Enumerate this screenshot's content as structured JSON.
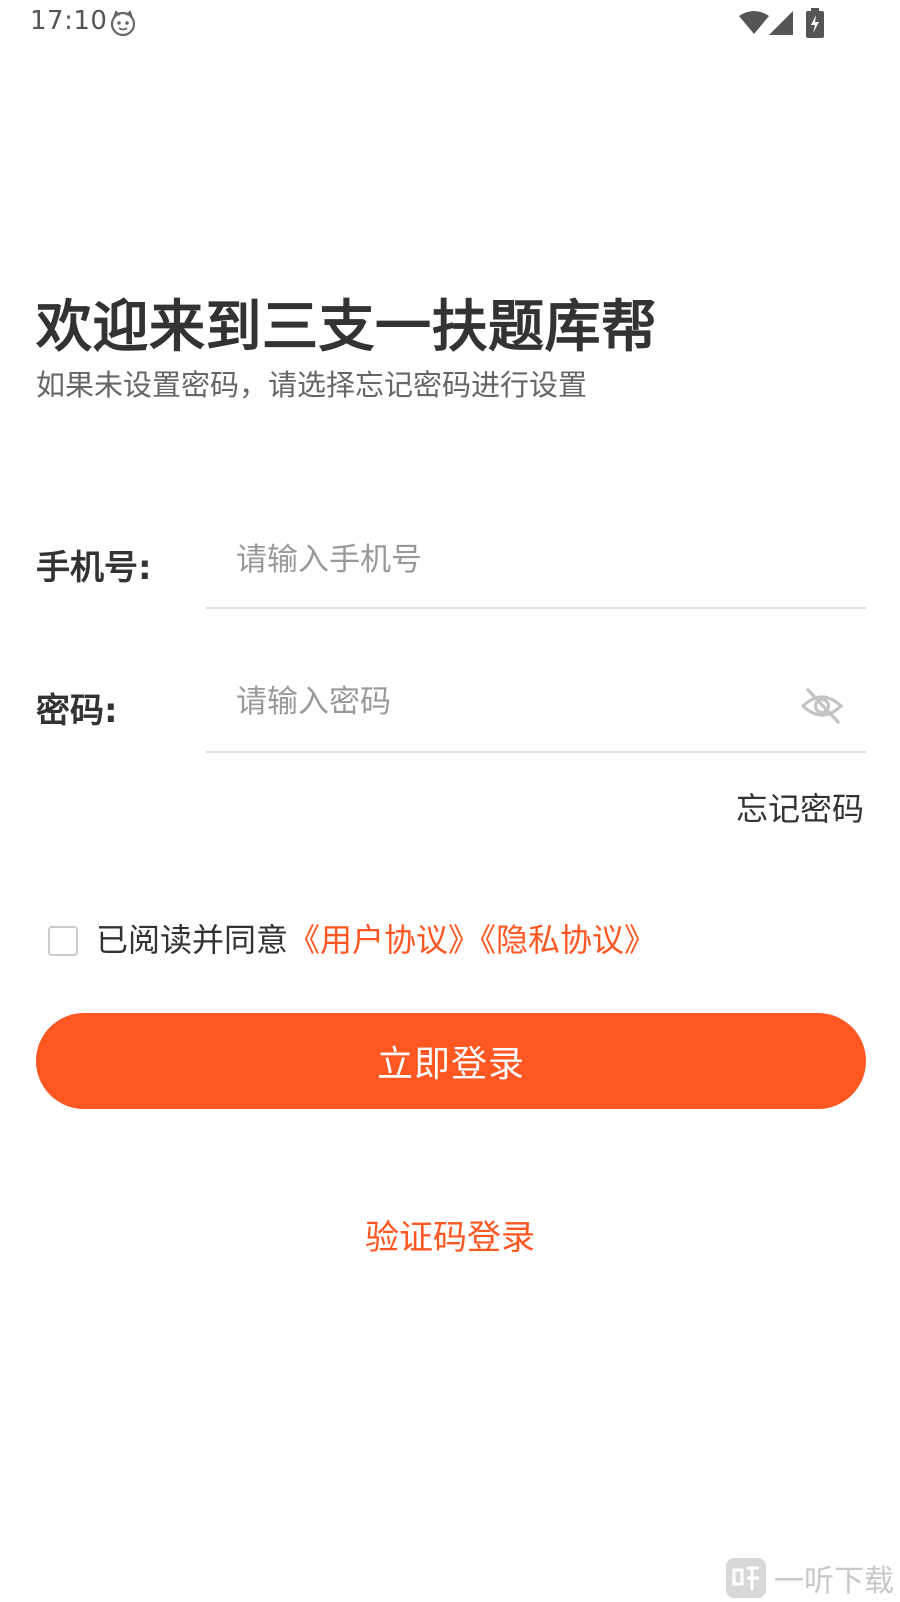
{
  "status_bar": {
    "time": "17:10",
    "icons": [
      "cat-notification-icon",
      "wifi-icon",
      "signal-icon",
      "battery-charging-icon"
    ]
  },
  "header": {
    "title": "欢迎来到三支一扶题库帮",
    "subtitle": "如果未设置密码，请选择忘记密码进行设置"
  },
  "form": {
    "phone_label": "手机号:",
    "phone_placeholder": "请输入手机号",
    "phone_value": "",
    "password_label": "密码:",
    "password_placeholder": "请输入密码",
    "password_value": "",
    "password_toggle_icon": "eye-off-icon",
    "forgot_password": "忘记密码"
  },
  "agreement": {
    "checked": false,
    "text": "已阅读并同意",
    "user_agreement": "《用户协议》",
    "privacy_agreement": "《隐私协议》"
  },
  "actions": {
    "login_label": "立即登录",
    "sms_login_label": "验证码登录"
  },
  "watermark": {
    "logo_glyph": "听",
    "text": "一听下载"
  },
  "colors": {
    "accent": "#ff5722",
    "text_primary": "#333333",
    "text_secondary": "#666666",
    "placeholder": "#999999",
    "divider": "#e2e2e2"
  }
}
